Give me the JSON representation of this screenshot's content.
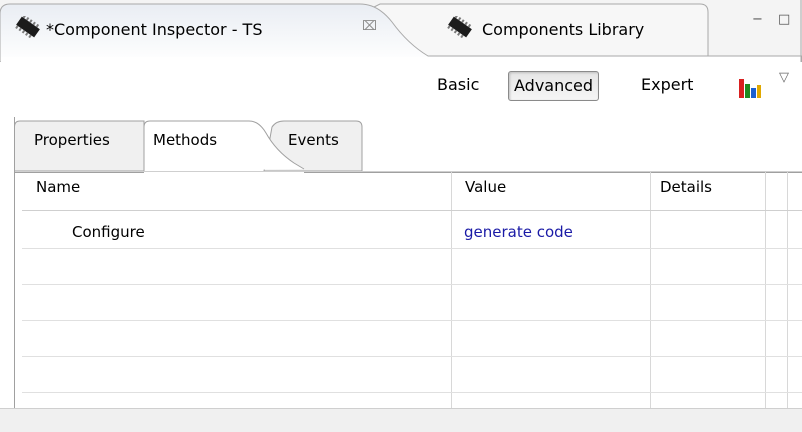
{
  "tabs": [
    {
      "label": "*Component Inspector - TS",
      "close": "⌧",
      "icon": "chip-icon",
      "active": true
    },
    {
      "label": "Components Library",
      "icon": "chip-icon",
      "active": false
    }
  ],
  "window_controls": {
    "minimize": "−",
    "maximize": "□"
  },
  "modes": [
    "Basic",
    "Advanced",
    "Expert"
  ],
  "selected_mode": "Advanced",
  "toolbar_icons": [
    "bar-chart-icon",
    "view-menu-icon"
  ],
  "subtabs": [
    "Properties",
    "Methods",
    "Events"
  ],
  "active_subtab": "Methods",
  "table": {
    "columns": [
      "Name",
      "Value",
      "Details"
    ],
    "rows": [
      {
        "name": "Configure",
        "value": "generate code",
        "details": ""
      }
    ]
  },
  "colors": {
    "link": "#1a1aa6"
  }
}
